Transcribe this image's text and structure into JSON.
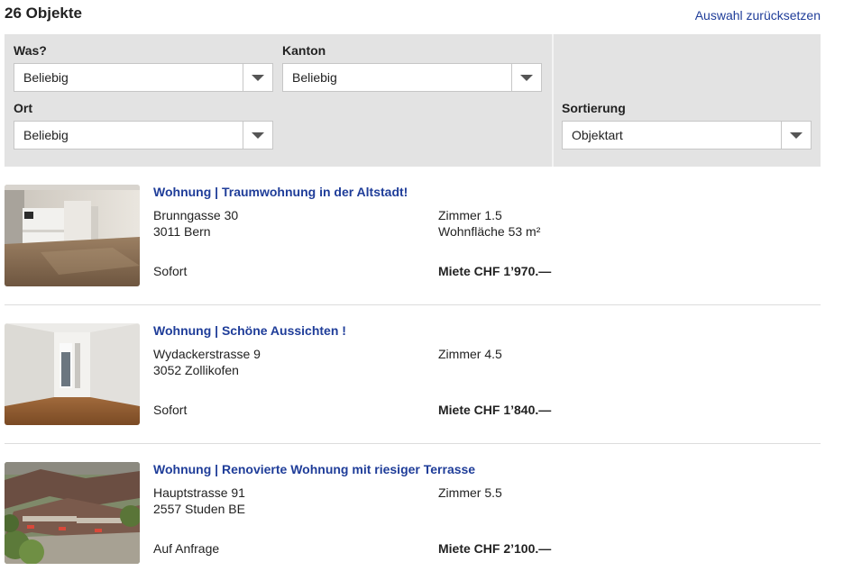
{
  "header": {
    "count": "26 Objekte",
    "reset_label": "Auswahl zurücksetzen"
  },
  "filters": {
    "was": {
      "label": "Was?",
      "value": "Beliebig"
    },
    "kanton": {
      "label": "Kanton",
      "value": "Beliebig"
    },
    "ort": {
      "label": "Ort",
      "value": "Beliebig"
    },
    "sortierung": {
      "label": "Sortierung",
      "value": "Objektart"
    }
  },
  "listings": [
    {
      "title": "Wohnung | Traumwohnung in der Altstadt!",
      "street": "Brunngasse 30",
      "city": "3011 Bern",
      "availability": "Sofort",
      "rooms": "Zimmer 1.5",
      "area": "Wohnfläche 53 m²",
      "price": "Miete CHF 1’970.—"
    },
    {
      "title": "Wohnung | Schöne Aussichten !",
      "street": "Wydackerstrasse 9",
      "city": "3052 Zollikofen",
      "availability": "Sofort",
      "rooms": "Zimmer 4.5",
      "price": "Miete CHF 1’840.—"
    },
    {
      "title": "Wohnung | Renovierte Wohnung mit riesiger Terrasse",
      "street": "Hauptstrasse 91",
      "city": "2557 Studen BE",
      "availability": "Auf Anfrage",
      "rooms": "Zimmer 5.5",
      "price": "Miete CHF 2’100.—"
    }
  ]
}
